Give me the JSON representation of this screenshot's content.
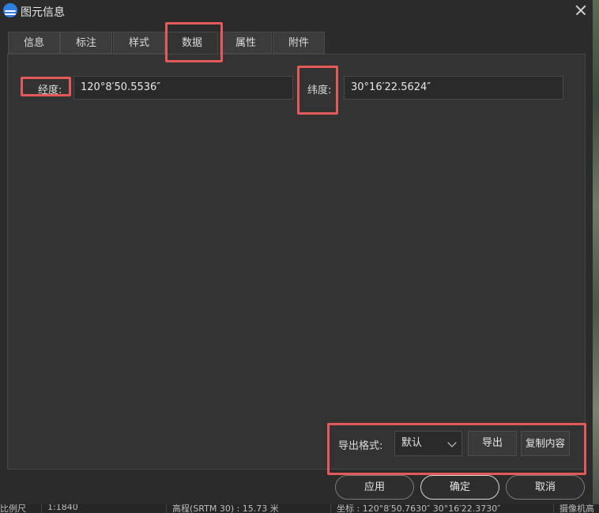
{
  "window": {
    "title": "图元信息"
  },
  "tabs": [
    {
      "label": "信息"
    },
    {
      "label": "标注"
    },
    {
      "label": "样式"
    },
    {
      "label": "数据",
      "active": true
    },
    {
      "label": "属性"
    },
    {
      "label": "附件"
    }
  ],
  "data_tab": {
    "longitude": {
      "label": "经度:",
      "value": "120°8′50.5536″"
    },
    "latitude": {
      "label": "纬度:",
      "value": "30°16′22.5624″"
    }
  },
  "export": {
    "format_label": "导出格式:",
    "format_selected": "默认",
    "export_button": "导出",
    "copy_button": "复制内容"
  },
  "footer": {
    "apply_button": "应用",
    "ok_button": "确定",
    "cancel_button": "取消"
  },
  "status_bar": {
    "seg1": "比例尺",
    "seg2": "1:1840",
    "seg3": "高程(SRTM 30) : 15.73 米",
    "seg4": "坐标 : 120°8′50.7630″ 30°16′22.3730″",
    "seg5": "摄像机高"
  },
  "colors": {
    "highlight": "#e45a5a",
    "app_icon": "#2f7fe0"
  }
}
